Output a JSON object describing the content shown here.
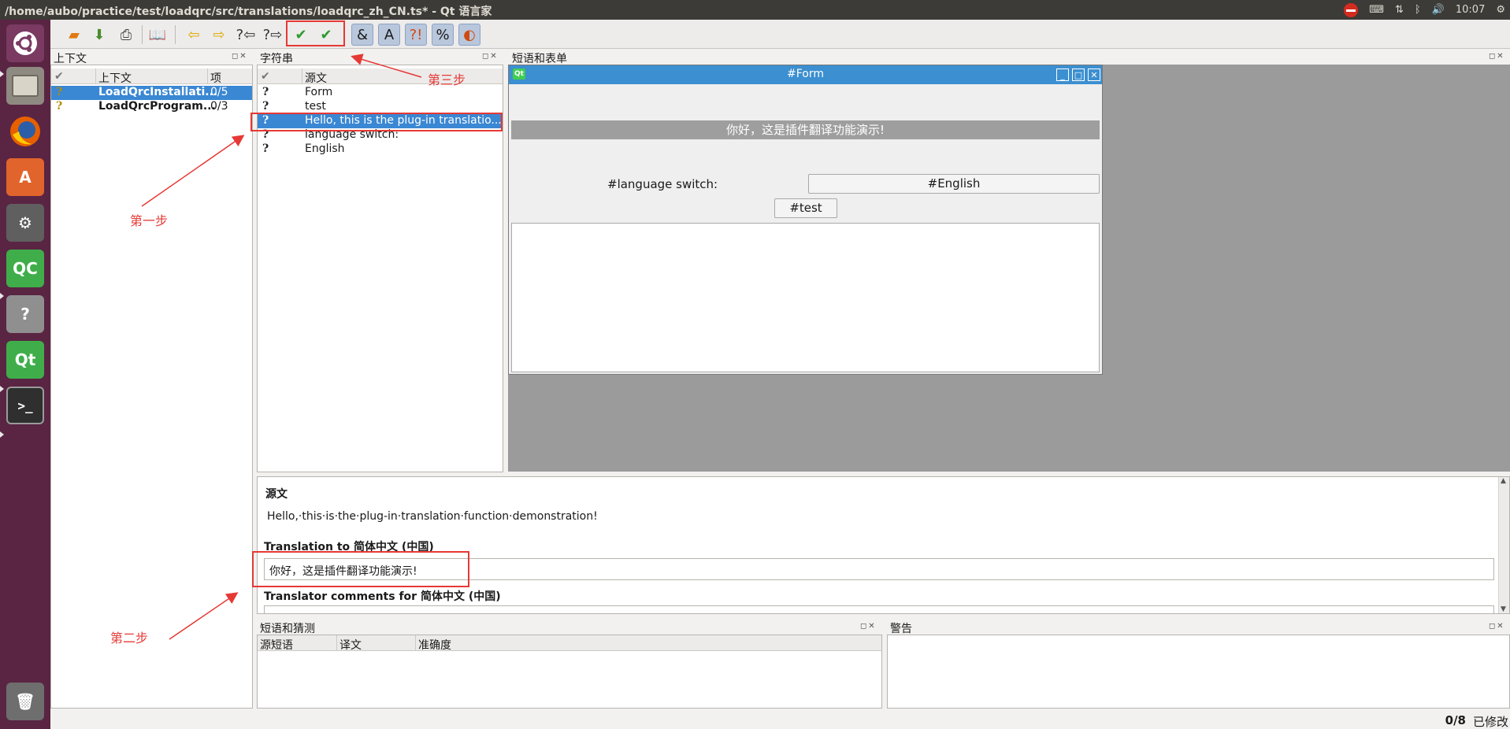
{
  "window": {
    "title": "/home/aubo/practice/test/loadqrc/src/translations/loadqrc_zh_CN.ts* - Qt 语言家"
  },
  "tray": {
    "time": "10:07"
  },
  "launcher": {
    "qtcreator_label": "QC",
    "qt_label": "Qt"
  },
  "context_pane": {
    "title": "上下文",
    "headers": [
      "上下文",
      "项"
    ],
    "rows": [
      {
        "name": "LoadQrcInstallati...",
        "items": "0/5"
      },
      {
        "name": "LoadQrcProgram...",
        "items": "0/3"
      }
    ]
  },
  "strings_pane": {
    "title": "字符串",
    "header_source": "源文",
    "rows": [
      "Form",
      "test",
      "Hello, this is the plug-in translatio...",
      "language switch:",
      "English"
    ]
  },
  "forms_pane": {
    "title": "短语和表单",
    "form_title": "#Form",
    "qt_badge": "Qt",
    "hello_text": "你好，这是插件翻译功能演示!",
    "language_label": "#language switch:",
    "english_button": "#English",
    "test_button": "#test"
  },
  "editor": {
    "source_heading": "源文",
    "source_text": "Hello,·this·is·the·plug-in·translation·function·demonstration!",
    "translation_label": "Translation to 简体中文 (中国)",
    "translation_value": "你好，这是插件翻译功能演示!",
    "comments_label": "Translator comments for 简体中文 (中国)"
  },
  "phrases_pane": {
    "title": "短语和猜测",
    "headers": [
      "源短语",
      "译文",
      "准确度"
    ]
  },
  "warnings_pane": {
    "title": "警告"
  },
  "status": {
    "count": "0/8",
    "modified": "已修改"
  },
  "annotations": {
    "step1": "第一步",
    "step2": "第二步",
    "step3": "第三步"
  },
  "colors": {
    "accent": "#3a87d3",
    "annotation_red": "#e53935",
    "launcher": "#5a2443",
    "titlebar": "#3c3b37"
  }
}
